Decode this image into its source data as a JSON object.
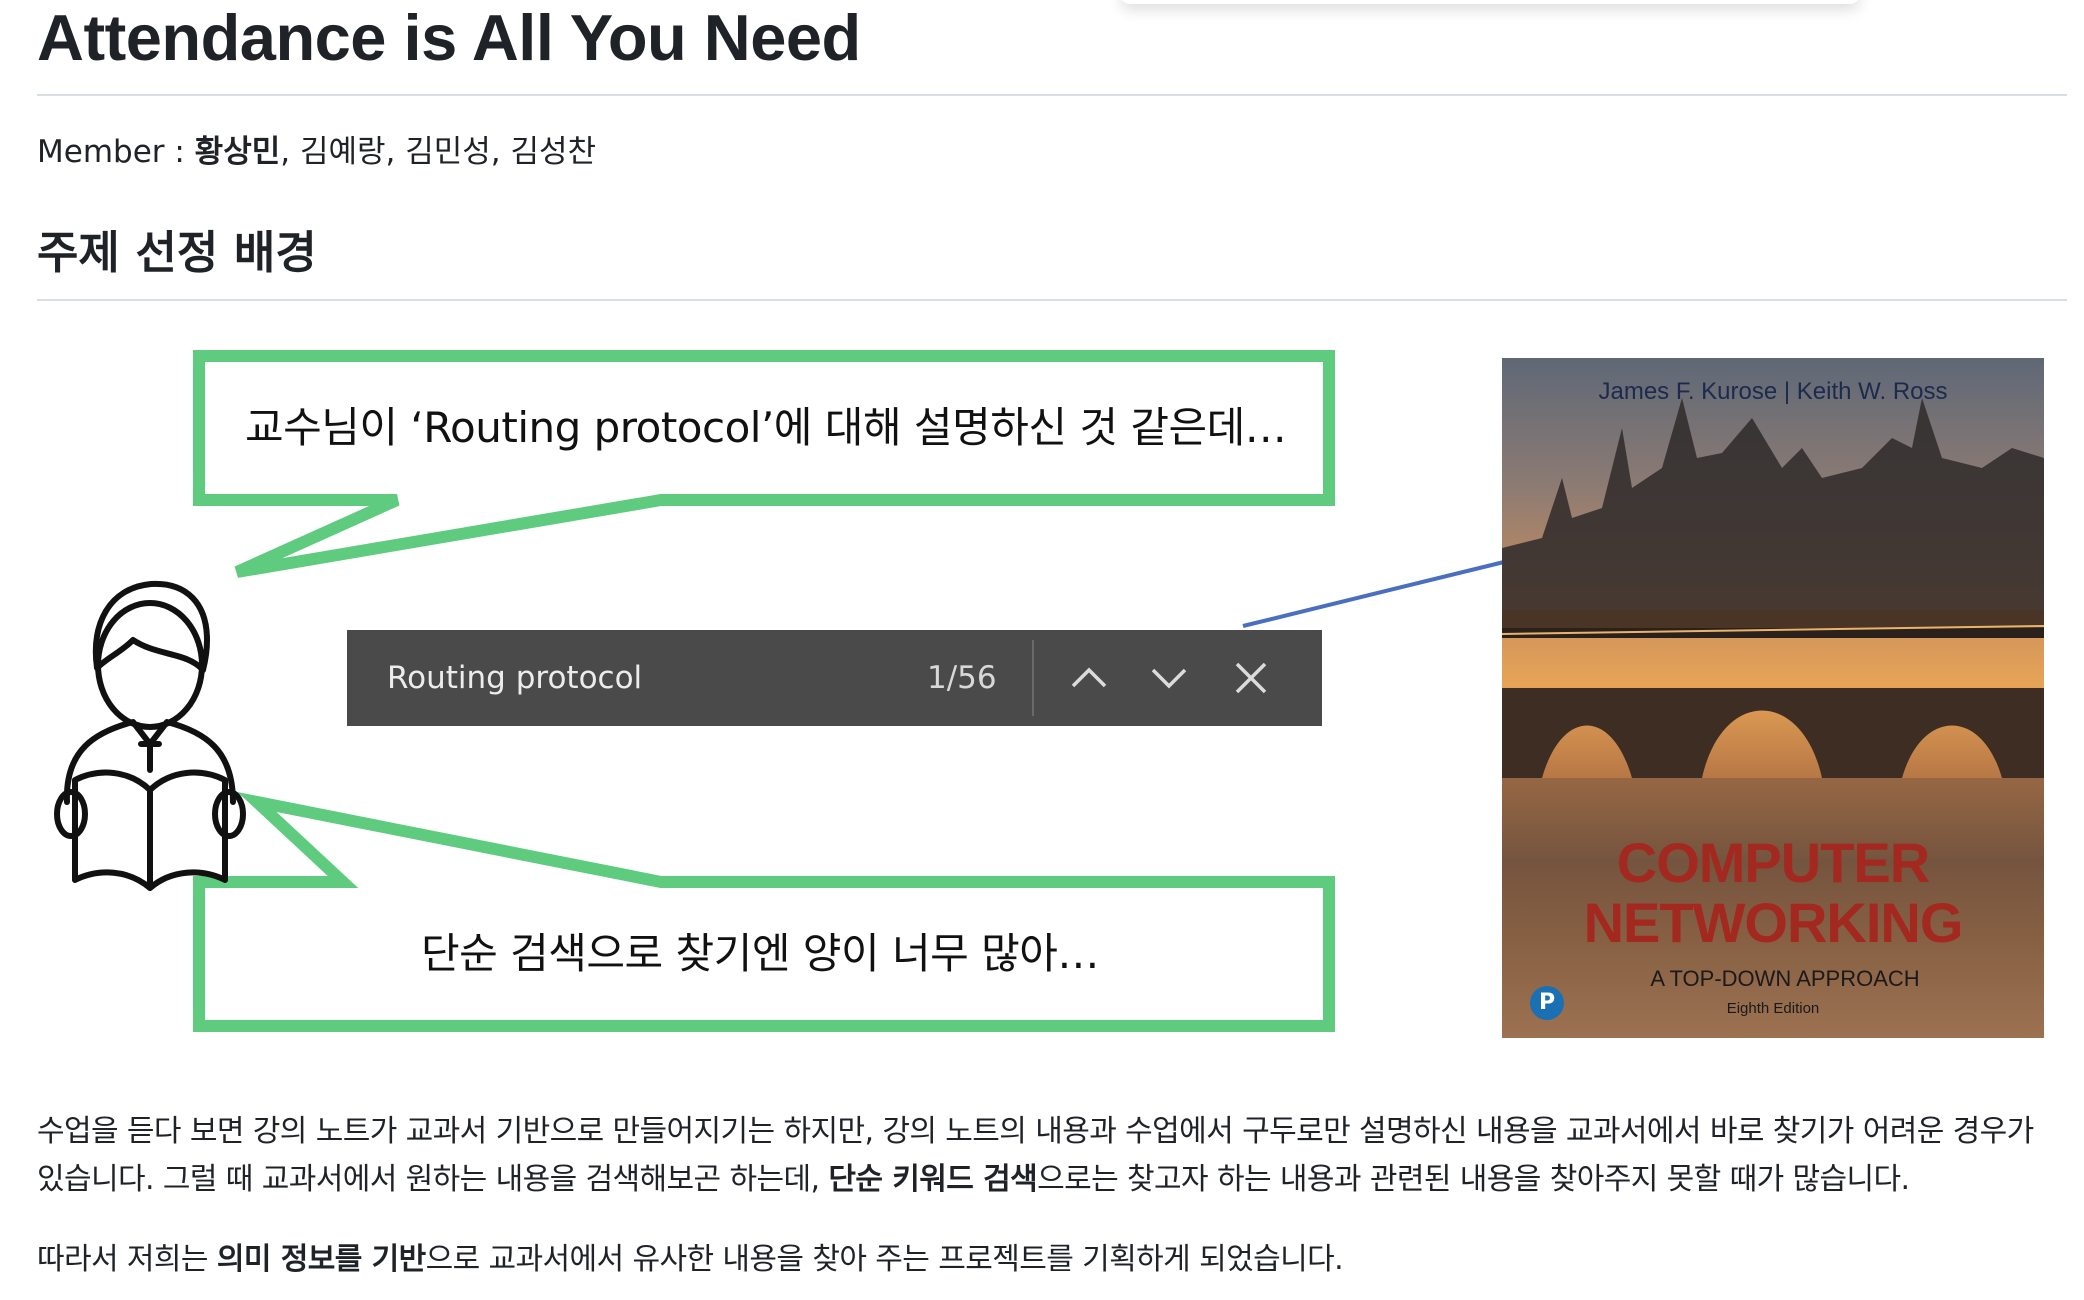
{
  "doc": {
    "title": "Attendance is All You Need",
    "members_label": "Member : ",
    "members_lead": "황상민",
    "members_rest": ", 김예랑, 김민성, 김성찬",
    "section_title": "주제 선정 배경"
  },
  "illustration": {
    "bubble_top_text": "교수님이 ‘Routing protocol’에 대해 설명하신 것 같은데…",
    "bubble_bottom_text": "단순 검색으로 찾기엔 양이 너무 많아…",
    "search_query": "Routing protocol",
    "search_count": "1/56",
    "colors": {
      "bubble_stroke": "#5ecb7f",
      "connector": "#4a6fc0",
      "search_bg": "#4a4a4a"
    },
    "icons": [
      "student-reading-icon",
      "chevron-up-icon",
      "chevron-down-icon",
      "close-icon"
    ]
  },
  "book": {
    "author1": "James F. Kurose",
    "author_sep": "|",
    "author2": "Keith W. Ross",
    "title_line1": "COMPUTER",
    "title_line2": "NETWORKING",
    "subtitle": "A TOP-DOWN APPROACH",
    "edition": "Eighth Edition",
    "publisher_mark": "P"
  },
  "body": {
    "p1_a": "수업을 듣다 보면 강의 노트가 교과서 기반으로 만들어지기는 하지만, 강의 노트의 내용과 수업에서 구두로만 설명하신 내용을 교과서에서 바로 찾기가 어려운 경우가 있습니다. 그럴 때 교과서에서 원하는 내용을 검색해보곤 하는데, ",
    "p1_bold": "단순 키워드 검색",
    "p1_b": "으로는 찾고자 하는 내용과 관련된 내용을 찾아주지 못할 때가 많습니다.",
    "p2_a": "따라서 저희는 ",
    "p2_bold": "의미 정보를 기반",
    "p2_b": "으로 교과서에서 유사한 내용을 찾아 주는 프로젝트를 기획하게 되었습니다."
  }
}
